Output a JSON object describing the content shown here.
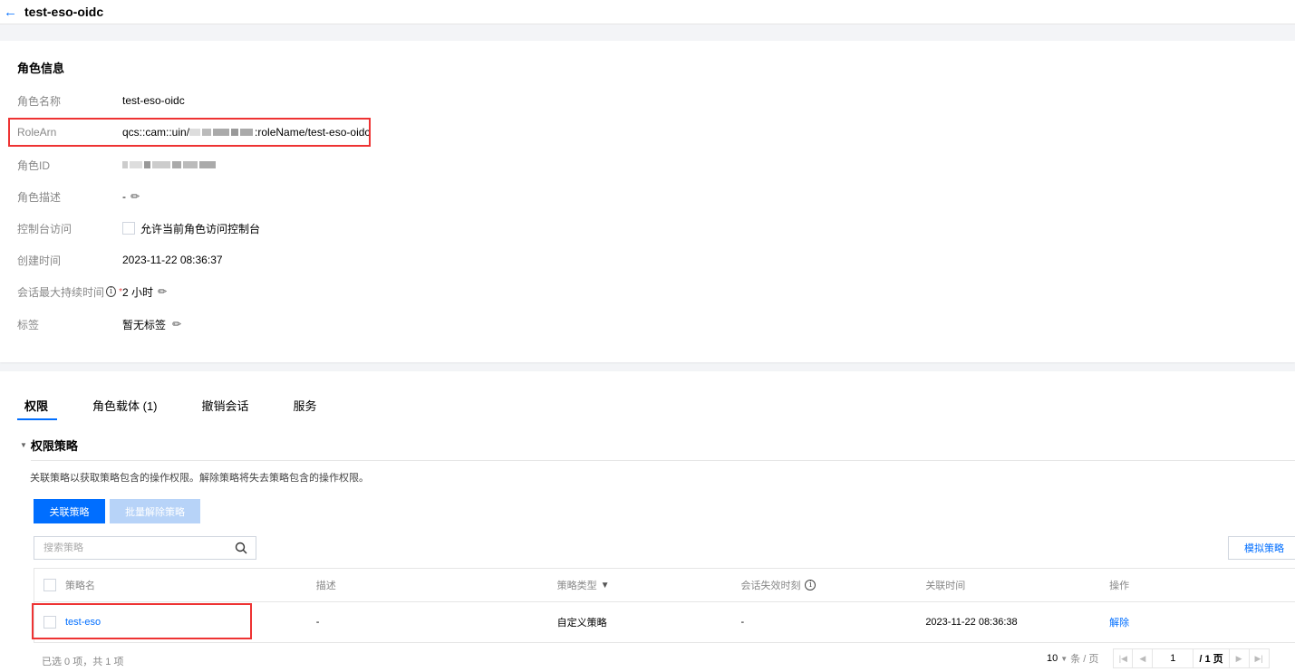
{
  "header": {
    "back_icon": "arrow-left-icon",
    "title": "test-eso-oidc"
  },
  "role_info": {
    "section_title": "角色信息",
    "rows": {
      "name": {
        "label": "角色名称",
        "value": "test-eso-oidc"
      },
      "arn": {
        "label": "RoleArn",
        "value_prefix": "qcs::cam::uin/",
        "value_suffix": ":roleName/test-eso-oidc"
      },
      "id": {
        "label": "角色ID"
      },
      "desc": {
        "label": "角色描述",
        "value": "-"
      },
      "console": {
        "label": "控制台访问",
        "checkbox_label": "允许当前角色访问控制台"
      },
      "created": {
        "label": "创建时间",
        "value": "2023-11-22 08:36:37"
      },
      "session": {
        "label": "会话最大持续时间",
        "required_mark": "*",
        "value": "2 小时"
      },
      "tags": {
        "label": "标签",
        "value": "暂无标签"
      }
    }
  },
  "tabs": [
    {
      "label": "权限",
      "active": true
    },
    {
      "label": "角色载体 (1)"
    },
    {
      "label": "撤销会话"
    },
    {
      "label": "服务"
    }
  ],
  "policy_section": {
    "title": "权限策略",
    "description": "关联策略以获取策略包含的操作权限。解除策略将失去策略包含的操作权限。",
    "attach_button": "关联策略",
    "batch_detach_button": "批量解除策略",
    "search_placeholder": "搜索策略",
    "simulate_button": "模拟策略"
  },
  "table": {
    "columns": [
      "策略名",
      "描述",
      "策略类型",
      "会话失效时刻",
      "关联时间",
      "操作"
    ],
    "rows": [
      {
        "name": "test-eso",
        "desc": "-",
        "type": "自定义策略",
        "expire": "-",
        "time": "2023-11-22 08:36:38",
        "action": "解除"
      }
    ]
  },
  "footer": {
    "summary": "已选 0 项，共 1 项",
    "page_size": "10",
    "per_page_label": "条 / 页",
    "current_page": "1",
    "total_pages": "/ 1 页"
  },
  "colors": {
    "accent": "#006eff",
    "highlight": "#e33333",
    "disabled": "#b7d3f8"
  }
}
